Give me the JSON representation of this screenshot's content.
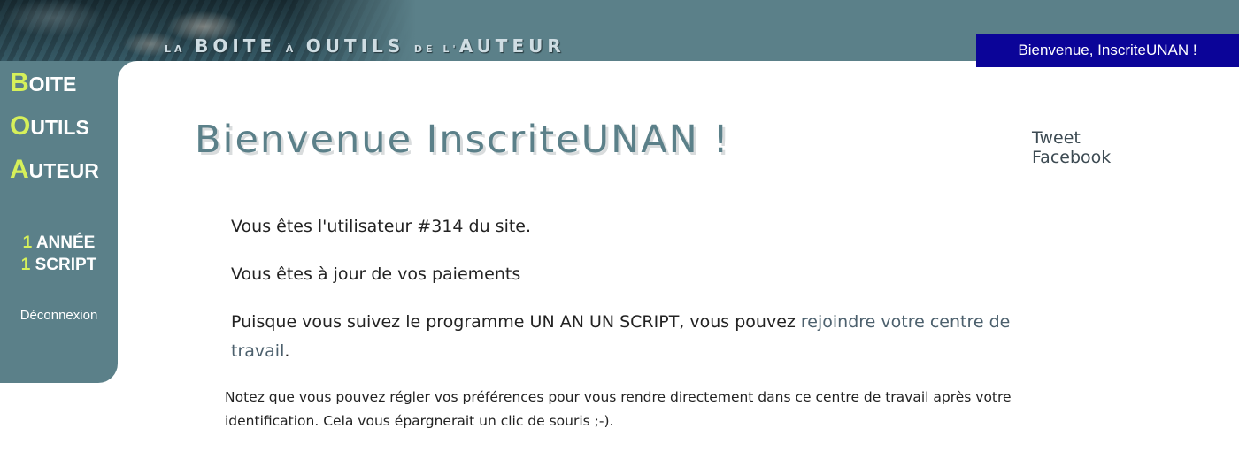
{
  "header": {
    "banner_title": {
      "part1": "LA",
      "part2": "BOITE",
      "part3": "À",
      "part4": "OUTILS",
      "part5": "DE L'",
      "part6": "AUTEUR"
    },
    "welcome_badge": "Bienvenue, InscriteUNAN !"
  },
  "sidebar": {
    "brand": [
      {
        "first": "B",
        "rest": "OITE"
      },
      {
        "first": "O",
        "rest": "UTILS"
      },
      {
        "first": "A",
        "rest": "UTEUR"
      }
    ],
    "program": [
      {
        "num": "1",
        "label": "ANNÉE"
      },
      {
        "num": "1",
        "label": "SCRIPT"
      }
    ],
    "logout_label": "Déconnexion"
  },
  "main": {
    "title": "Bienvenue InscriteUNAN !",
    "social": {
      "tweet_label": "Tweet",
      "facebook_label": "Facebook"
    },
    "user_number_text": "Vous êtes l'utilisateur #314 du site.",
    "payment_text": "Vous êtes à jour de vos paiements",
    "program_text_before": "Puisque vous suivez le programme UN AN UN SCRIPT, vous pouvez ",
    "program_link": "rejoindre votre centre de travail",
    "program_text_after": ".",
    "note_text": "Notez que vous pouvez régler vos préférences pour vous rendre directement dans ce centre de travail après votre identification. Cela vous épargnerait un clic de souris ;-)."
  },
  "colors": {
    "header_bg": "#5b8089",
    "badge_bg": "#0b0498",
    "brand_accent": "#d6f05a",
    "title_color": "#5b8089"
  }
}
